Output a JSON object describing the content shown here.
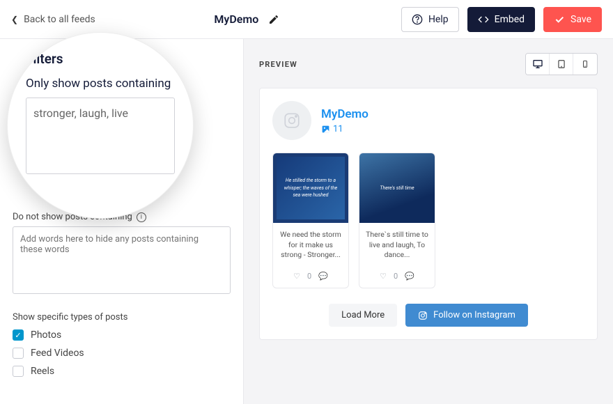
{
  "topbar": {
    "back_label": "Back to all feeds",
    "title": "MyDemo",
    "help_label": "Help",
    "embed_label": "Embed",
    "save_label": "Save"
  },
  "magnifier": {
    "heading": "Filters",
    "label": "Only show posts containing",
    "value": "stronger, laugh, live"
  },
  "sidebar": {
    "exclude_label": "Do not show posts containing",
    "exclude_placeholder": "Add words here to hide any posts containing these words",
    "types_heading": "Show specific types of posts",
    "types": [
      {
        "label": "Photos",
        "checked": true
      },
      {
        "label": "Feed Videos",
        "checked": false
      },
      {
        "label": "Reels",
        "checked": false
      }
    ]
  },
  "preview": {
    "label": "PREVIEW",
    "profile_name": "MyDemo",
    "profile_count": "11",
    "posts": [
      {
        "thumb_text": "He stilled the storm\nto a whisper;\nthe waves of the sea\nwere hushed",
        "caption": "We need the storm for it make us strong - Stronger..."
      },
      {
        "thumb_text": "There's still time",
        "caption": "There`s still time to live and laugh, To dance..."
      }
    ],
    "like_count": "0",
    "comment_count": "0",
    "load_more_label": "Load More",
    "follow_label": "Follow on Instagram"
  }
}
